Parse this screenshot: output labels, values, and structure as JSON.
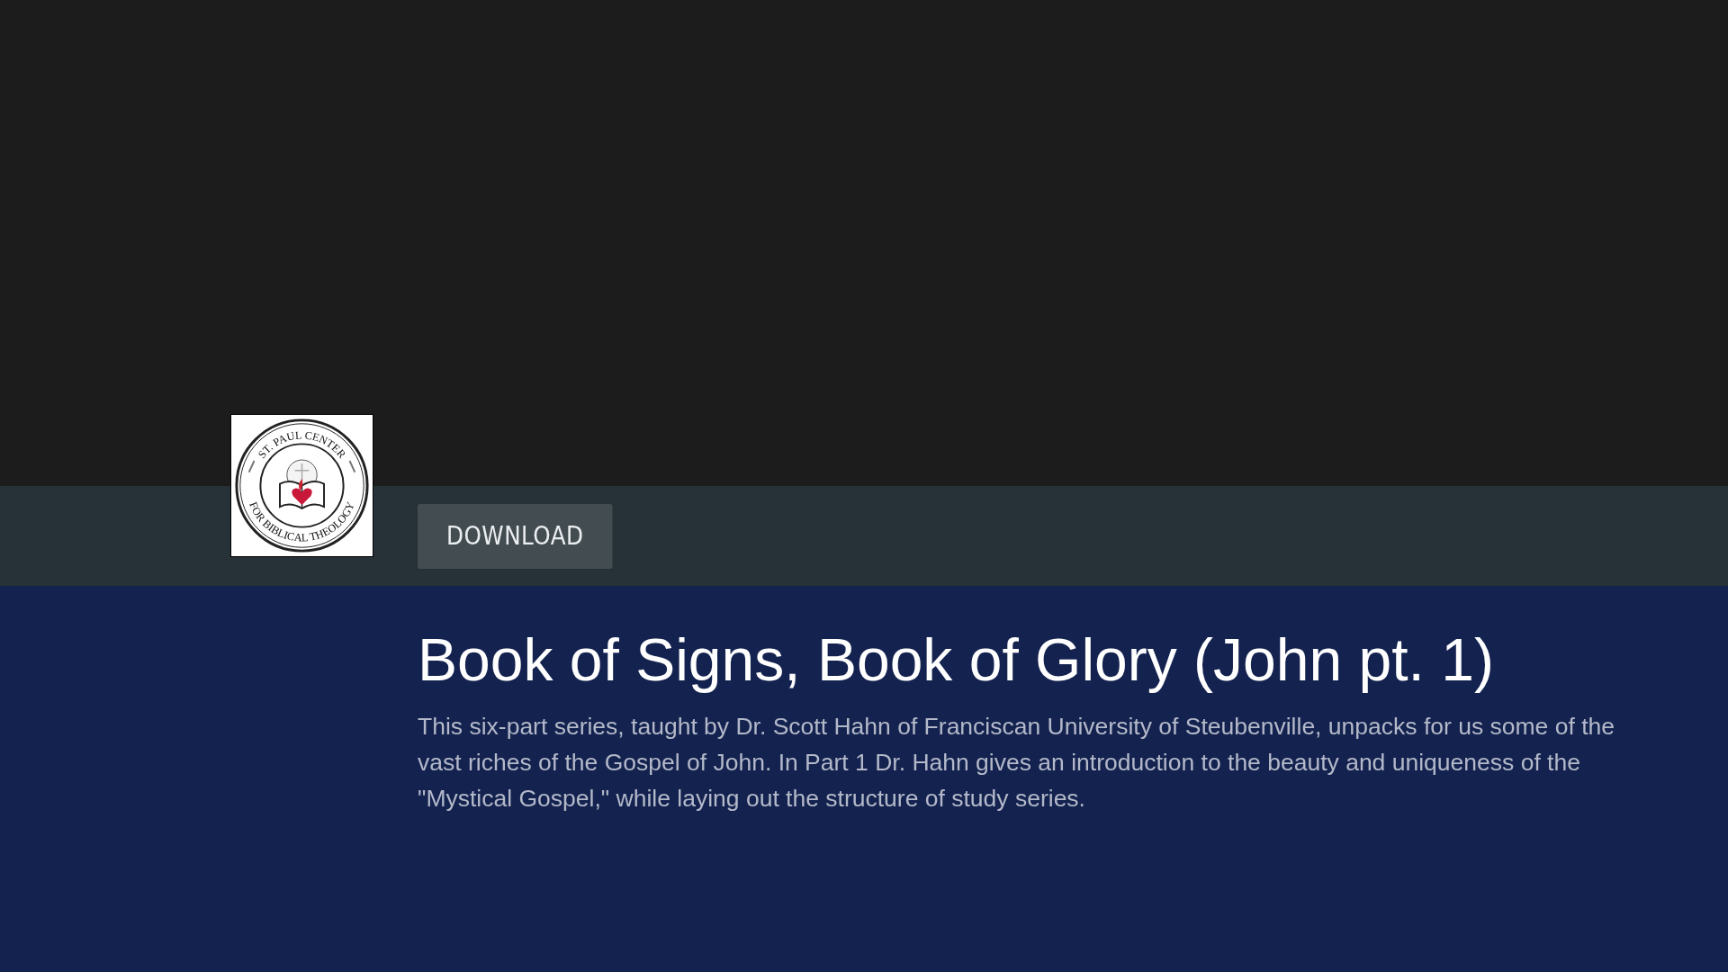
{
  "logo": {
    "top_text": "ST. PAUL CENTER",
    "bottom_text": "FOR BIBLICAL THEOLOGY"
  },
  "actions": [
    {
      "label": "DOWNLOAD"
    }
  ],
  "title": "Book of Signs, Book of Glory (John pt. 1)",
  "description": "This six-part series, taught by Dr. Scott Hahn of Franciscan University of Steubenville, unpacks for us some of the vast riches of the Gospel of John. In Part 1 Dr. Hahn gives an introduction to the beauty and uniqueness of the \"Mystical Gospel,\" while laying out the structure of study series."
}
